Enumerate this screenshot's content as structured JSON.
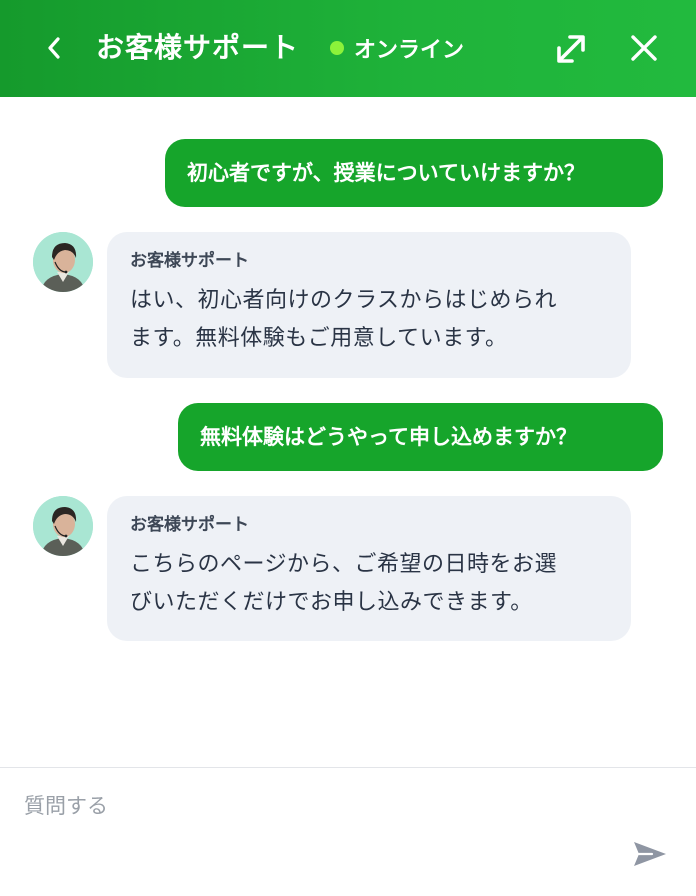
{
  "header": {
    "title": "お客様サポート",
    "status_label": "オンライン",
    "status_color": "#8cf23a",
    "back_icon": "chevron-left-icon",
    "expand_icon": "expand-icon",
    "close_icon": "close-icon"
  },
  "messages": [
    {
      "role": "user",
      "text": "初心者ですが、授業についていけますか？"
    },
    {
      "role": "agent",
      "sender": "お客様サポート",
      "lines": [
        "はい、初心者向けのクラスからはじめられ",
        "ます。無料体験もご用意しています。"
      ]
    },
    {
      "role": "user",
      "text": "無料体験はどうやって申し込めますか？"
    },
    {
      "role": "agent",
      "sender": "お客様サポート",
      "lines": [
        "こちらのページから、ご希望の日時をお選",
        "びいただくだけでお申し込みできます。"
      ]
    }
  ],
  "composer": {
    "placeholder": "質問する",
    "value": "",
    "send_icon": "send-icon"
  },
  "colors": {
    "brand_green": "#16a52b",
    "agent_bubble": "#eef1f6"
  }
}
